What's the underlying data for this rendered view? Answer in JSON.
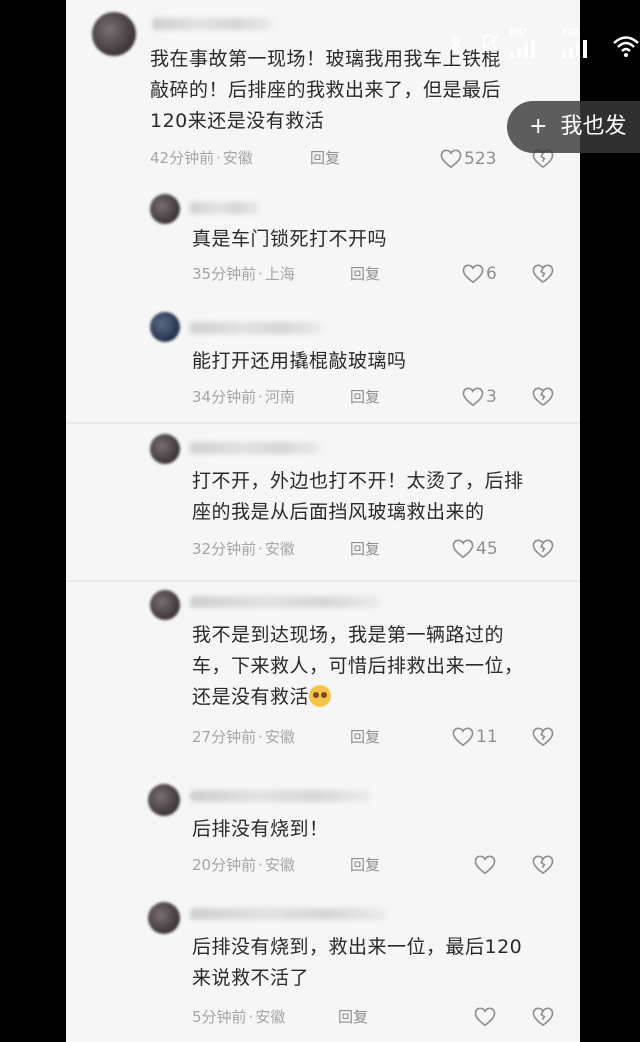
{
  "post_button": {
    "plus": "+",
    "label": "我也发"
  },
  "status": {
    "hd1": "HD",
    "hd2": "HD"
  },
  "comments": [
    {
      "lines": [
        "我在事故第一现场！玻璃我用我车上铁棍",
        "敲碎的！后排座的我救出来了，但是最后",
        "120来还是没有救活"
      ],
      "time": "42分钟前",
      "location": "安徽",
      "reply": "回复",
      "likes": "523"
    },
    {
      "lines": [
        "真是车门锁死打不开吗"
      ],
      "time": "35分钟前",
      "location": "上海",
      "reply": "回复",
      "likes": "6"
    },
    {
      "lines": [
        "能打开还用撬棍敲玻璃吗"
      ],
      "time": "34分钟前",
      "location": "河南",
      "reply": "回复",
      "likes": "3"
    },
    {
      "lines": [
        "打不开，外边也打不开！太烫了，后排",
        "座的我是从后面挡风玻璃救出来的"
      ],
      "time": "32分钟前",
      "location": "安徽",
      "reply": "回复",
      "likes": "45"
    },
    {
      "lines": [
        "我不是到达现场，我是第一辆路过的",
        "车，下来救人，可惜后排救出来一位，",
        "还是没有救活"
      ],
      "time": "27分钟前",
      "location": "安徽",
      "reply": "回复",
      "likes": "11"
    },
    {
      "lines": [
        "后排没有烧到！"
      ],
      "time": "20分钟前",
      "location": "安徽",
      "reply": "回复",
      "likes": ""
    },
    {
      "lines": [
        "后排没有烧到，救出来一位，最后120",
        "来说救不活了"
      ],
      "time": "5分钟前",
      "location": "安徽",
      "reply": "回复",
      "likes": ""
    }
  ],
  "colors": {
    "page_bg": "#f6f6f6",
    "text": "#2a2a2a",
    "meta": "#a5a5a5"
  }
}
